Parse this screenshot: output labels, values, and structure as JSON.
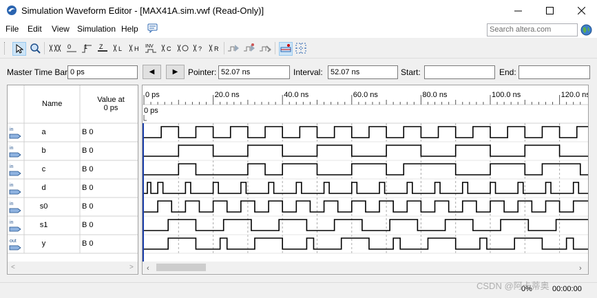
{
  "window": {
    "title": "Simulation Waveform Editor - [MAX41A.sim.vwf (Read-Only)]"
  },
  "menu": [
    "File",
    "Edit",
    "View",
    "Simulation",
    "Help"
  ],
  "search": {
    "placeholder": "Search altera.com"
  },
  "toolbar": {
    "icons": [
      "selection-tool-icon",
      "zoom-tool-icon",
      "forcing-unknown-icon",
      "forcing-low-icon",
      "forcing-high-icon",
      "high-impedance-icon",
      "weak-low-icon",
      "weak-high-icon",
      "invert-icon",
      "count-value-icon",
      "overwrite-clock-icon",
      "random-values-icon",
      "dont-care-icon",
      "overwrite-value-icon",
      "run-functional-sim-icon",
      "run-timing-sim-icon",
      "generate-netlist-icon",
      "snap-to-grid-icon",
      "grid-icon"
    ]
  },
  "timebar": {
    "master_label": "Master Time Bar:",
    "master_value": "0 ps",
    "prev": "◀",
    "next": "▶",
    "pointer_label": "Pointer:",
    "pointer_value": "52.07 ns",
    "interval_label": "Interval:",
    "interval_value": "52.07 ns",
    "start_label": "Start:",
    "start_value": "",
    "end_label": "End:",
    "end_value": ""
  },
  "table": {
    "name_header": "Name",
    "value_header_line1": "Value at",
    "value_header_line2": "0 ps"
  },
  "signals": [
    {
      "dir": "in",
      "name": "a",
      "value": "B 0"
    },
    {
      "dir": "in",
      "name": "b",
      "value": "B 0"
    },
    {
      "dir": "in",
      "name": "c",
      "value": "B 0"
    },
    {
      "dir": "in",
      "name": "d",
      "value": "B 0"
    },
    {
      "dir": "in",
      "name": "s0",
      "value": "B 0"
    },
    {
      "dir": "in",
      "name": "s1",
      "value": "B 0"
    },
    {
      "dir": "out",
      "name": "y",
      "value": "B 0"
    }
  ],
  "timeline": {
    "ticks": [
      "0 ps",
      "20.0 ns",
      "40.0 ns",
      "60.0 ns",
      "80.0 ns",
      "100.0 ns",
      "120.0 ns"
    ],
    "cursor_label": "0 ps"
  },
  "status": {
    "progress": "0%",
    "elapsed": "00:00:00"
  },
  "watermark": "CSDN @阿卡蒂奥"
}
